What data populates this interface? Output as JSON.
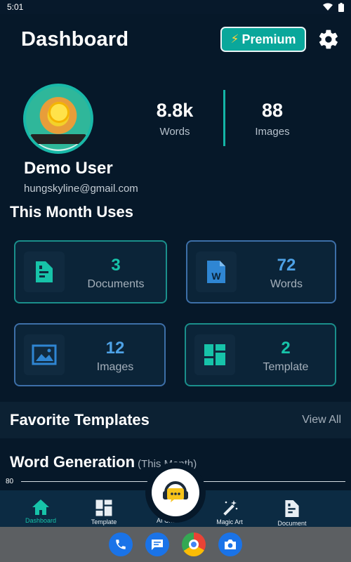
{
  "status_bar": {
    "time": "5:01"
  },
  "header": {
    "title": "Dashboard",
    "premium_label": "Premium"
  },
  "profile": {
    "name": "Demo User",
    "email": "hungskyline@gmail.com",
    "stats": [
      {
        "value": "8.8k",
        "label": "Words"
      },
      {
        "value": "88",
        "label": "Images"
      }
    ]
  },
  "month_uses": {
    "title": "This Month Uses",
    "cards": [
      {
        "value": "3",
        "label": "Documents",
        "icon": "document-icon",
        "accent": "#17c3a9"
      },
      {
        "value": "72",
        "label": "Words",
        "icon": "word-file-icon",
        "accent": "#4ea2e6"
      },
      {
        "value": "12",
        "label": "Images",
        "icon": "image-icon",
        "accent": "#4ea2e6"
      },
      {
        "value": "2",
        "label": "Template",
        "icon": "template-icon",
        "accent": "#17c3a9"
      }
    ]
  },
  "favorites": {
    "title": "Favorite Templates",
    "view_all": "View All"
  },
  "word_generation": {
    "title": "Word Generation",
    "subtitle": "(This Month)",
    "y_tick": "80"
  },
  "bottom_nav": {
    "items": [
      {
        "label": "Dashboard",
        "icon": "home-icon",
        "active": true
      },
      {
        "label": "Template",
        "icon": "template-icon",
        "active": false
      },
      {
        "label": "AI Chat",
        "icon": "chat-support-icon",
        "active": false
      },
      {
        "label": "Magic Art",
        "icon": "magic-wand-icon",
        "active": false
      },
      {
        "label": "Document",
        "icon": "document-icon",
        "active": false
      }
    ]
  },
  "system_dock": [
    "phone-icon",
    "messages-icon",
    "chrome-icon",
    "camera-icon"
  ],
  "colors": {
    "background": "#061829",
    "accent_teal": "#17c3a9",
    "accent_blue": "#4ea2e6",
    "premium": "#0aa79b"
  }
}
